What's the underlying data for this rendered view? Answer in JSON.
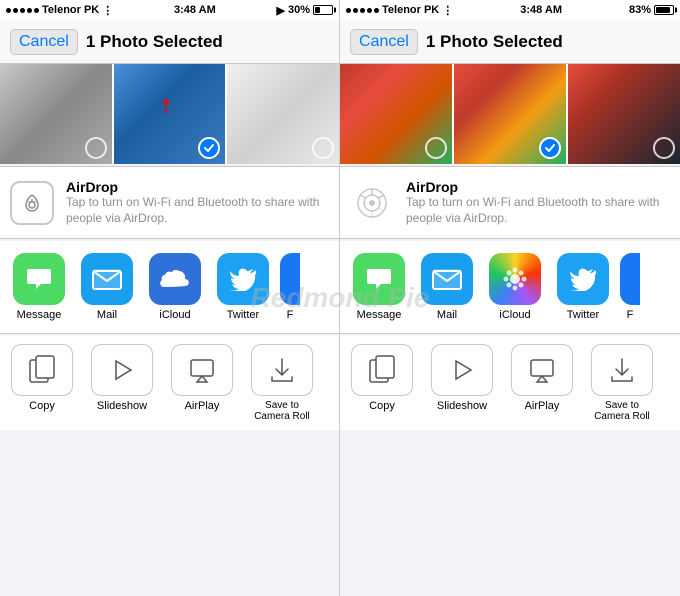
{
  "left_panel": {
    "status": {
      "carrier": "Telenor PK",
      "time": "3:48 AM",
      "signal": 5,
      "battery": 30,
      "battery_label": "30%"
    },
    "nav": {
      "cancel_label": "Cancel",
      "title": "1 Photo Selected"
    },
    "photos": [
      {
        "id": "people",
        "selected": false,
        "type": "people"
      },
      {
        "id": "man-blue",
        "selected": true,
        "type": "man-blue",
        "has_arrow": true
      },
      {
        "id": "screenshot",
        "selected": false,
        "type": "screenshot"
      }
    ],
    "airdrop": {
      "title": "AirDrop",
      "description": "Tap to turn on Wi-Fi and Bluetooth to share with people via AirDrop."
    },
    "apps": [
      {
        "id": "message",
        "label": "Message",
        "color": "message"
      },
      {
        "id": "mail",
        "label": "Mail",
        "color": "mail"
      },
      {
        "id": "icloud",
        "label": "iCloud",
        "color": "icloud"
      },
      {
        "id": "twitter",
        "label": "Twitter",
        "color": "twitter"
      },
      {
        "id": "more",
        "label": "F",
        "color": "partial"
      }
    ],
    "actions": [
      {
        "id": "copy",
        "label": "Copy",
        "icon": "copy"
      },
      {
        "id": "slideshow",
        "label": "Slideshow",
        "icon": "slideshow"
      },
      {
        "id": "airplay",
        "label": "AirPlay",
        "icon": "airplay"
      },
      {
        "id": "save",
        "label": "Save to\nCamera Roll",
        "icon": "save"
      }
    ]
  },
  "right_panel": {
    "status": {
      "carrier": "Telenor PK",
      "time": "3:48 AM",
      "signal": 5,
      "battery": 83,
      "battery_label": "83%"
    },
    "nav": {
      "cancel_label": "Cancel",
      "title": "1 Photo Selected"
    },
    "photos": [
      {
        "id": "parrot",
        "selected": false,
        "type": "parrot"
      },
      {
        "id": "parrot2",
        "selected": true,
        "type": "parrot"
      },
      {
        "id": "hand",
        "selected": false,
        "type": "hand"
      }
    ],
    "airdrop": {
      "title": "AirDrop",
      "description": "Tap to turn on Wi-Fi and Bluetooth to share with people via AirDrop."
    },
    "apps": [
      {
        "id": "message",
        "label": "Message",
        "color": "message"
      },
      {
        "id": "mail",
        "label": "Mail",
        "color": "mail"
      },
      {
        "id": "photos",
        "label": "iCloud",
        "color": "icloud"
      },
      {
        "id": "twitter",
        "label": "Twitter",
        "color": "twitter"
      },
      {
        "id": "more",
        "label": "F",
        "color": "partial"
      }
    ],
    "actions": [
      {
        "id": "copy",
        "label": "Copy",
        "icon": "copy"
      },
      {
        "id": "slideshow",
        "label": "Slideshow",
        "icon": "slideshow"
      },
      {
        "id": "airplay",
        "label": "AirPlay",
        "icon": "airplay"
      },
      {
        "id": "save",
        "label": "Save to Camera Roll",
        "icon": "save"
      }
    ]
  },
  "watermark": "Redmond Pie"
}
